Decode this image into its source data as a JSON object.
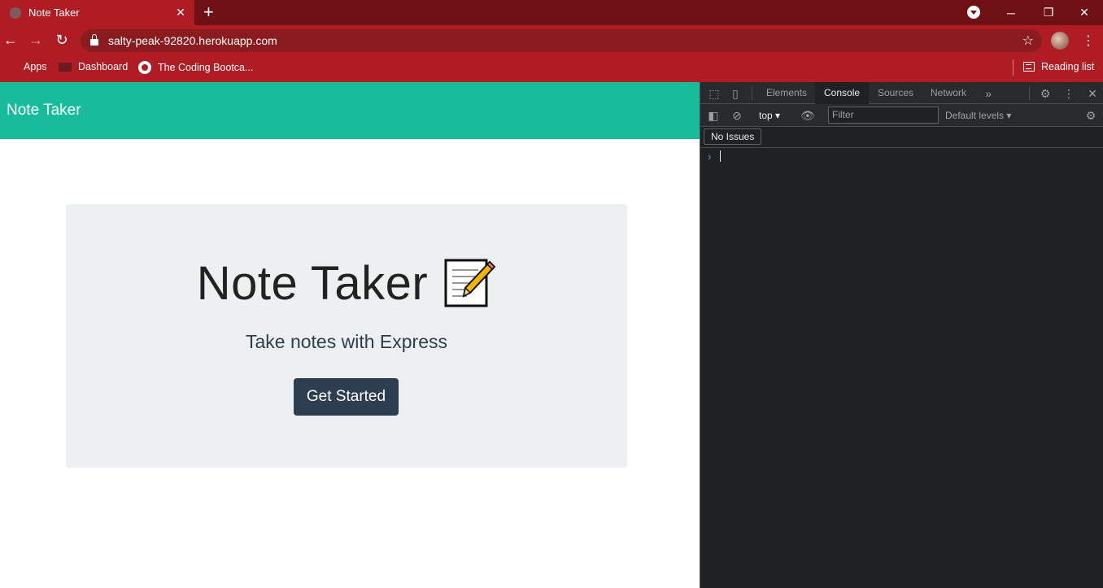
{
  "browser": {
    "tab_title": "Note Taker",
    "tab_close": "✕",
    "new_tab": "+",
    "url": "salty-peak-92820.herokuapp.com",
    "window_controls": {
      "minimize": "─",
      "restore": "❐",
      "close": "✕"
    },
    "bookmarks": [
      {
        "label": "Apps",
        "icon": "apps-grid-icon"
      },
      {
        "label": "Dashboard",
        "icon": "dashboard-icon"
      },
      {
        "label": "The Coding Bootca...",
        "icon": "github-icon"
      }
    ],
    "reading_list": "Reading list"
  },
  "page": {
    "brand": "Note Taker",
    "jumbotron": {
      "title": "Note Taker",
      "title_emoji": "notepad-with-pencil-icon",
      "lead": "Take notes with Express",
      "cta_label": "Get Started"
    },
    "colors": {
      "navbar": "#18bc9c",
      "jumbotron_bg": "#ecf0f1",
      "button": "#2c3e50"
    }
  },
  "devtools": {
    "tabs": [
      "Elements",
      "Console",
      "Sources",
      "Network"
    ],
    "active_tab": "Console",
    "context": "top",
    "filter_placeholder": "Filter",
    "levels": "Default levels",
    "issues": "No Issues",
    "prompt": "›"
  }
}
